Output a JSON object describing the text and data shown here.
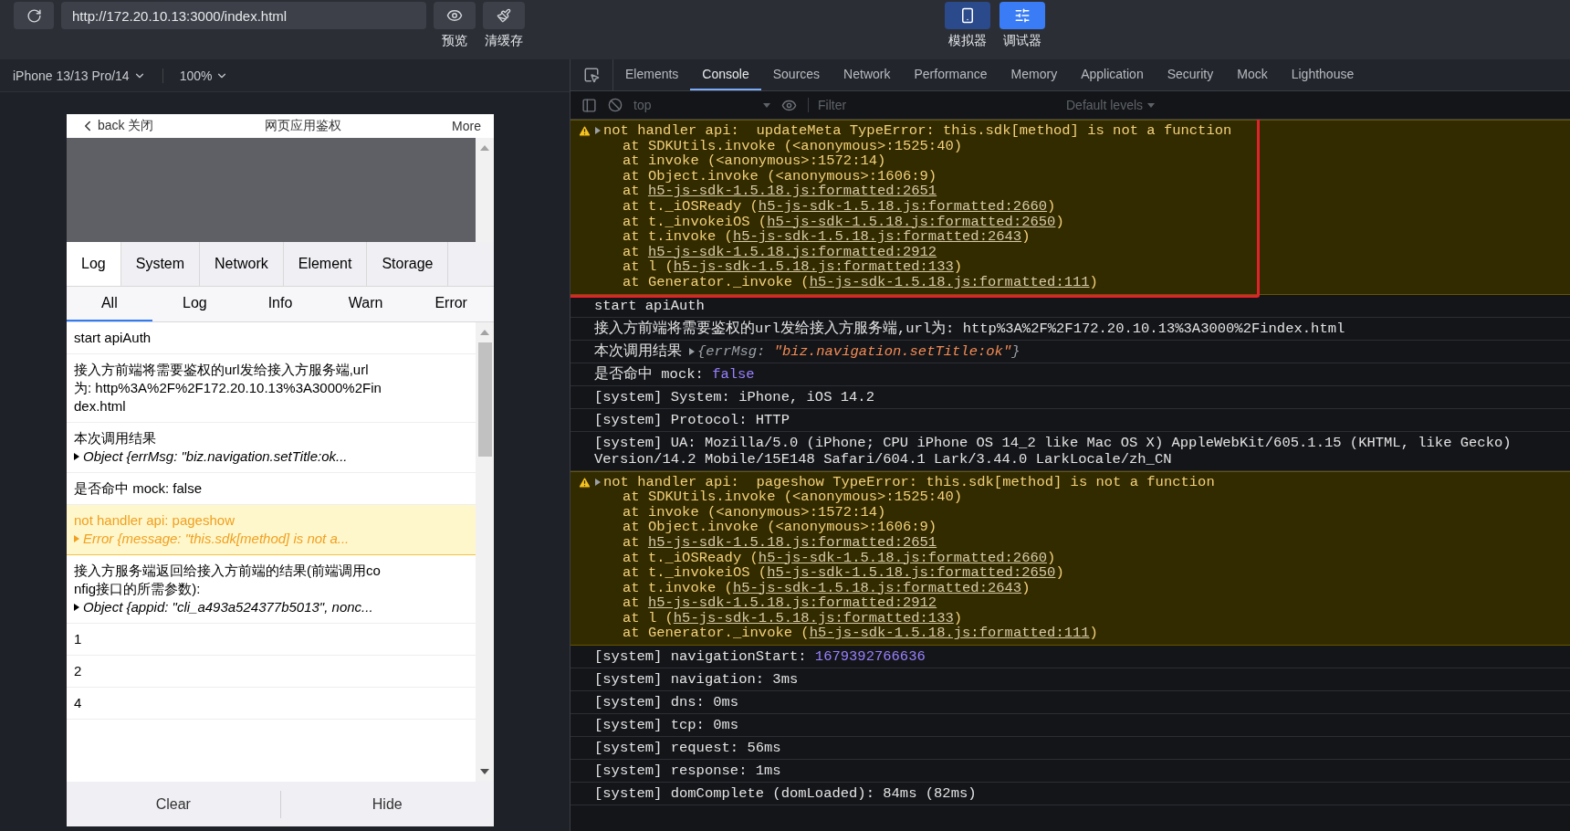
{
  "toolbar": {
    "url": "http://172.20.10.13:3000/index.html",
    "actions": [
      {
        "label": "预览",
        "kind": "eye"
      },
      {
        "label": "清缓存",
        "kind": "brush"
      }
    ],
    "modes": [
      {
        "label": "模拟器",
        "kind": "phone",
        "selected": false
      },
      {
        "label": "调试器",
        "kind": "sliders",
        "selected": true
      }
    ]
  },
  "device_bar": {
    "device": "iPhone 13/13 Pro/14",
    "zoom": "100%"
  },
  "phone": {
    "nav": {
      "left": "back 关闭",
      "title": "网页应用鉴权",
      "right": "More"
    },
    "tabs": [
      {
        "label": "Log",
        "selected": true
      },
      {
        "label": "System",
        "selected": false
      },
      {
        "label": "Network",
        "selected": false
      },
      {
        "label": "Element",
        "selected": false
      },
      {
        "label": "Storage",
        "selected": false
      }
    ],
    "filters": [
      {
        "label": "All",
        "selected": true
      },
      {
        "label": "Log",
        "selected": false
      },
      {
        "label": "Info",
        "selected": false
      },
      {
        "label": "Warn",
        "selected": false
      },
      {
        "label": "Error",
        "selected": false
      }
    ],
    "logs": [
      {
        "kind": "log",
        "text": "start apiAuth"
      },
      {
        "kind": "log",
        "text": "接入方前端将需要鉴权的url发给接入方服务端,url为: http%3A%2F%2F172.20.10.13%3A3000%2Findex.html"
      },
      {
        "kind": "log",
        "text": "本次调用结果",
        "object": "Object {errMsg: \"biz.navigation.setTitle:ok..."
      },
      {
        "kind": "log",
        "text": "是否命中 mock: false"
      },
      {
        "kind": "warn",
        "text": "not handler api: pageshow",
        "object": "Error {message: \"this.sdk[method] is not a..."
      },
      {
        "kind": "log",
        "text": "接入方服务端返回给接入方前端的结果(前端调用config接口的所需参数):",
        "object": "Object {appid: \"cli_a493a524377b5013\", nonc..."
      },
      {
        "kind": "log",
        "text": "1"
      },
      {
        "kind": "log",
        "text": "2"
      },
      {
        "kind": "log",
        "text": "4"
      }
    ],
    "buttons": [
      "Clear",
      "Hide"
    ]
  },
  "devtools": {
    "tabs": [
      {
        "label": "Elements",
        "selected": false
      },
      {
        "label": "Console",
        "selected": true
      },
      {
        "label": "Sources",
        "selected": false
      },
      {
        "label": "Network",
        "selected": false
      },
      {
        "label": "Performance",
        "selected": false
      },
      {
        "label": "Memory",
        "selected": false
      },
      {
        "label": "Application",
        "selected": false
      },
      {
        "label": "Security",
        "selected": false
      },
      {
        "label": "Mock",
        "selected": false
      },
      {
        "label": "Lighthouse",
        "selected": false
      }
    ],
    "console_toolbar": {
      "context": "top",
      "filter_placeholder": "Filter",
      "levels": "Default levels"
    },
    "messages": [
      {
        "kind": "warning",
        "highlighted": true,
        "message": "not handler api:  updateMeta TypeError: this.sdk[method] is not a function",
        "stack": [
          {
            "text": "at SDKUtils.invoke (<anonymous>:1525:40)"
          },
          {
            "text": "at invoke (<anonymous>:1572:14)"
          },
          {
            "text": "at Object.invoke (<anonymous>:1606:9)"
          },
          {
            "text": "at ",
            "link": "h5-js-sdk-1.5.18.js:formatted:2651"
          },
          {
            "text": "at t._iOSReady (",
            "link": "h5-js-sdk-1.5.18.js:formatted:2660",
            "close": ")"
          },
          {
            "text": "at t._invokeiOS (",
            "link": "h5-js-sdk-1.5.18.js:formatted:2650",
            "close": ")"
          },
          {
            "text": "at t.invoke (",
            "link": "h5-js-sdk-1.5.18.js:formatted:2643",
            "close": ")"
          },
          {
            "text": "at ",
            "link": "h5-js-sdk-1.5.18.js:formatted:2912"
          },
          {
            "text": "at l (",
            "link": "h5-js-sdk-1.5.18.js:formatted:133",
            "close": ")"
          },
          {
            "text": "at Generator._invoke (",
            "link": "h5-js-sdk-1.5.18.js:formatted:111",
            "close": ")"
          }
        ]
      },
      {
        "kind": "log",
        "text": "start apiAuth"
      },
      {
        "kind": "log",
        "text": "接入方前端将需要鉴权的url发给接入方服务端,url为: http%3A%2F%2F172.20.10.13%3A3000%2Findex.html"
      },
      {
        "kind": "object",
        "text": "本次调用结果",
        "key": "{errMsg:",
        "value": "\"biz.navigation.setTitle:ok\"",
        "close": "}"
      },
      {
        "kind": "log",
        "text": "是否命中 mock:",
        "value": "false"
      },
      {
        "kind": "log",
        "text": "[system] System: iPhone, iOS 14.2"
      },
      {
        "kind": "log",
        "text": "[system] Protocol: HTTP"
      },
      {
        "kind": "log",
        "text": "[system] UA: Mozilla/5.0 (iPhone; CPU iPhone OS 14_2 like Mac OS X) AppleWebKit/605.1.15 (KHTML, like Gecko) Version/14.2 Mobile/15E148 Safari/604.1 Lark/3.44.0 LarkLocale/zh_CN"
      },
      {
        "kind": "warning",
        "highlighted": false,
        "message": "not handler api:  pageshow TypeError: this.sdk[method] is not a function",
        "stack": [
          {
            "text": "at SDKUtils.invoke (<anonymous>:1525:40)"
          },
          {
            "text": "at invoke (<anonymous>:1572:14)"
          },
          {
            "text": "at Object.invoke (<anonymous>:1606:9)"
          },
          {
            "text": "at ",
            "link": "h5-js-sdk-1.5.18.js:formatted:2651"
          },
          {
            "text": "at t._iOSReady (",
            "link": "h5-js-sdk-1.5.18.js:formatted:2660",
            "close": ")"
          },
          {
            "text": "at t._invokeiOS (",
            "link": "h5-js-sdk-1.5.18.js:formatted:2650",
            "close": ")"
          },
          {
            "text": "at t.invoke (",
            "link": "h5-js-sdk-1.5.18.js:formatted:2643",
            "close": ")"
          },
          {
            "text": "at ",
            "link": "h5-js-sdk-1.5.18.js:formatted:2912"
          },
          {
            "text": "at l (",
            "link": "h5-js-sdk-1.5.18.js:formatted:133",
            "close": ")"
          },
          {
            "text": "at Generator._invoke (",
            "link": "h5-js-sdk-1.5.18.js:formatted:111",
            "close": ")"
          }
        ]
      },
      {
        "kind": "log",
        "text": "[system] navigationStart:",
        "value": "1679392766636"
      },
      {
        "kind": "log",
        "text": "[system] navigation: 3ms"
      },
      {
        "kind": "log",
        "text": "[system] dns: 0ms"
      },
      {
        "kind": "log",
        "text": "[system] tcp: 0ms"
      },
      {
        "kind": "log",
        "text": "[system] request: 56ms"
      },
      {
        "kind": "log",
        "text": "[system] response: 1ms"
      },
      {
        "kind": "log",
        "text": "[system] domComplete (domLoaded): 84ms (82ms)"
      }
    ]
  }
}
